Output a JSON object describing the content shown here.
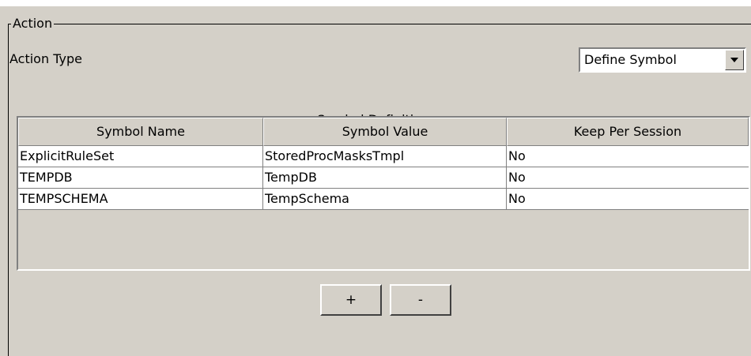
{
  "action_group": {
    "legend": "Action",
    "action_type_label": "Action Type",
    "action_type_combo": {
      "value": "Define Symbol",
      "dropdown_icon": "chevron-down-icon"
    }
  },
  "symbol_definition": {
    "title": "Symbol Definition",
    "columns": [
      "Symbol Name",
      "Symbol Value",
      "Keep Per Session"
    ],
    "rows": [
      [
        "ExplicitRuleSet",
        "StoredProcMasksTmpl",
        "No"
      ],
      [
        "TEMPDB",
        "TempDB",
        "No"
      ],
      [
        "TEMPSCHEMA",
        "TempSchema",
        "No"
      ]
    ]
  },
  "buttons": {
    "add_label": "+",
    "remove_label": "-"
  }
}
